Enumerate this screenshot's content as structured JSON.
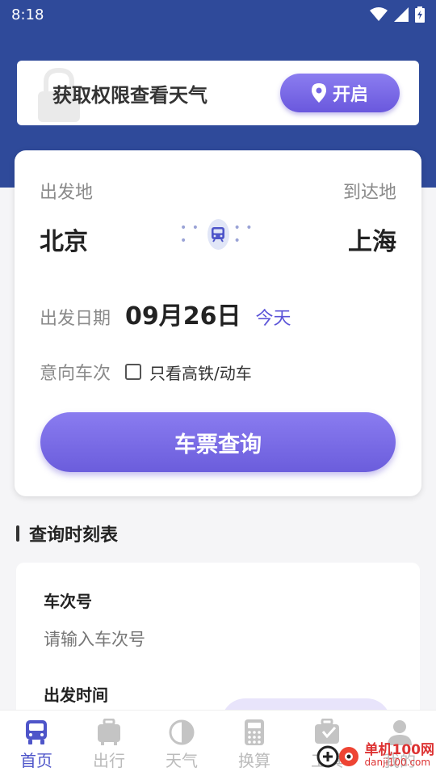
{
  "status_bar": {
    "time": "8:18"
  },
  "permission_banner": {
    "text": "获取权限查看天气",
    "button_label": "开启"
  },
  "ticket": {
    "from_label": "出发地",
    "to_label": "到达地",
    "from_city": "北京",
    "to_city": "上海",
    "date_label": "出发日期",
    "date_value": "09月26日",
    "date_today": "今天",
    "train_label": "意向车次",
    "high_speed_only": "只看高铁/动车",
    "high_speed_checked": false,
    "query_button": "车票查询"
  },
  "schedule": {
    "section_title": "查询时刻表",
    "train_no_label": "车次号",
    "train_no_placeholder": "请输入车次号",
    "depart_time_label": "出发时间"
  },
  "tabs": [
    {
      "label": "首页",
      "icon": "bus-icon",
      "active": true
    },
    {
      "label": "出行",
      "icon": "luggage-icon",
      "active": false
    },
    {
      "label": "天气",
      "icon": "weather-icon",
      "active": false
    },
    {
      "label": "换算",
      "icon": "calculator-icon",
      "active": false
    },
    {
      "label": "工具",
      "icon": "toolbox-icon",
      "active": false
    },
    {
      "label": "我的",
      "icon": "user-icon",
      "active": false
    }
  ],
  "watermark": {
    "main": "单机100网",
    "sub": "danji100.com"
  },
  "colors": {
    "header": "#2f4a9a",
    "accent": "#6b5ddc",
    "active_tab": "#4e55c9"
  }
}
